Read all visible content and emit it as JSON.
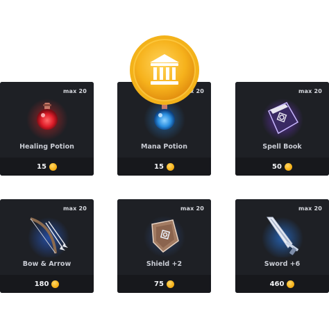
{
  "currency": {
    "icon": "gold-coin-icon",
    "badge_icon": "bank-building-icon",
    "color": "#f7b51c"
  },
  "items": [
    {
      "name": "Healing Potion",
      "max": "max 20",
      "price": "15",
      "icon": "healing-potion-icon"
    },
    {
      "name": "Mana Potion",
      "max": "max 20",
      "price": "15",
      "icon": "mana-potion-icon"
    },
    {
      "name": "Spell Book",
      "max": "max 20",
      "price": "50",
      "icon": "spell-book-icon"
    },
    {
      "name": "Bow & Arrow",
      "max": "max 20",
      "price": "180",
      "icon": "bow-and-arrow-icon"
    },
    {
      "name": "Shield +2",
      "max": "max 20",
      "price": "75",
      "icon": "shield-icon"
    },
    {
      "name": "Sword +6",
      "max": "max 20",
      "price": "460",
      "icon": "sword-icon"
    }
  ]
}
